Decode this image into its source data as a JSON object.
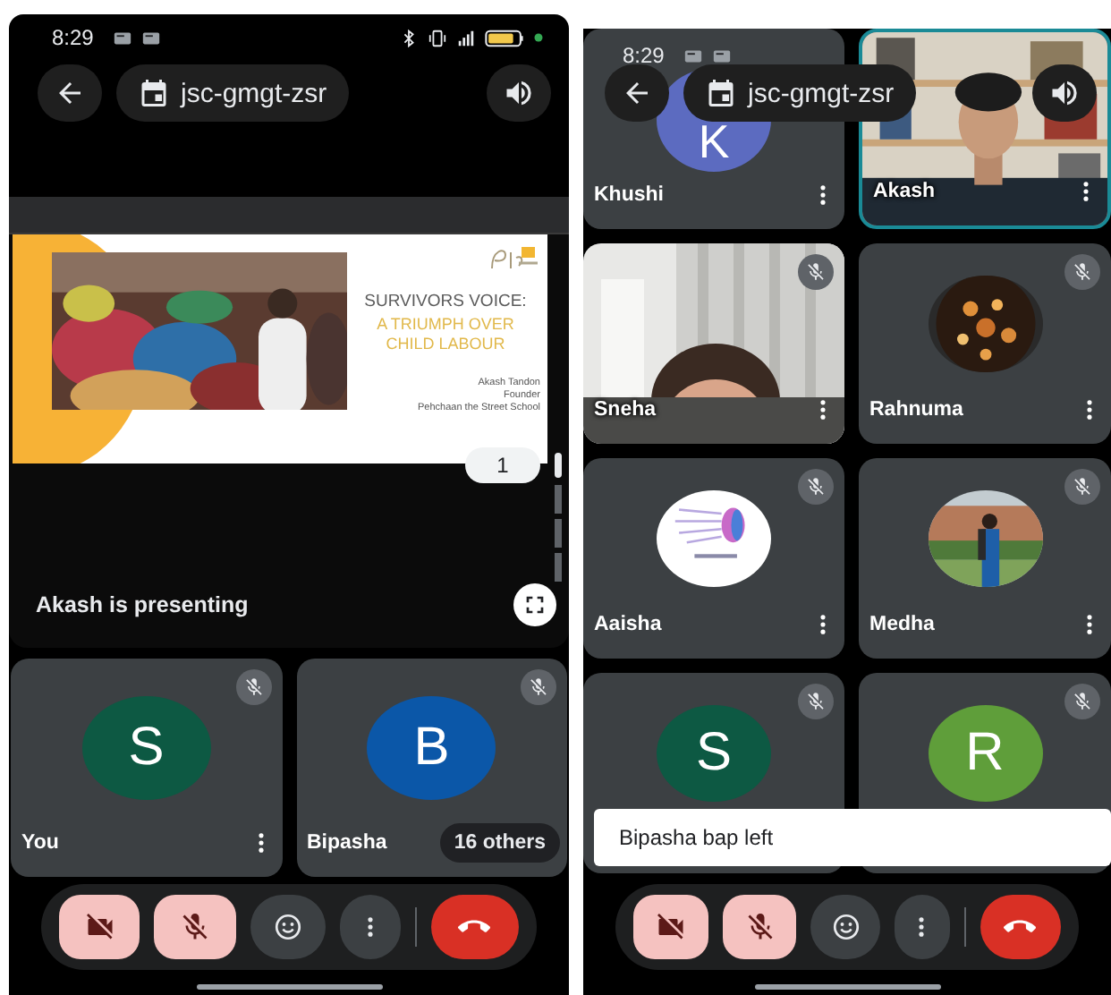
{
  "screens": [
    {
      "kind": "presentation",
      "status_bar": {
        "time": "8:29"
      },
      "meeting_code": "jsc-gmgt-zsr",
      "presentation": {
        "slide": {
          "title": "SURVIVORS VOICE:",
          "subtitle": "A TRIUMPH OVER CHILD LABOUR",
          "credits": [
            "Akash Tandon",
            "Founder",
            "Pehchaan the Street School"
          ]
        },
        "page": "1",
        "caption": "Akash is presenting"
      },
      "tiles": [
        {
          "name": "You",
          "kind": "letter",
          "initial": "S",
          "color": "#0d5943",
          "muted": true,
          "speaking": false,
          "menu": true
        },
        {
          "name": "Bipasha",
          "kind": "letter",
          "initial": "B",
          "color": "#0b57a8",
          "muted": true,
          "speaking": false,
          "menu": false,
          "badge": "16 others"
        }
      ],
      "controls": [
        {
          "kind": "camera",
          "on": false
        },
        {
          "kind": "mic",
          "on": false
        },
        {
          "kind": "reactions"
        },
        {
          "kind": "more"
        },
        {
          "kind": "end_call"
        }
      ]
    },
    {
      "kind": "grid",
      "status_bar": {
        "time": "8:29"
      },
      "meeting_code": "jsc-gmgt-zsr",
      "tiles": [
        {
          "name": "Khushi",
          "kind": "letter",
          "initial": "K",
          "color": "#5c6bc0",
          "muted": false,
          "speaking": false,
          "menu": true
        },
        {
          "name": "Akash",
          "kind": "video",
          "muted": false,
          "speaking": true,
          "menu": true
        },
        {
          "name": "Sneha",
          "kind": "video",
          "muted": true,
          "speaking": false,
          "menu": true
        },
        {
          "name": "Rahnuma",
          "muted": true,
          "speaking": false,
          "menu": true
        },
        {
          "name": "Aaisha",
          "muted": true,
          "speaking": false,
          "menu": true
        },
        {
          "name": "Medha",
          "muted": true,
          "speaking": false,
          "menu": true
        },
        {
          "kind": "letter",
          "initial": "S",
          "color": "#0d5943",
          "muted": true,
          "speaking": false,
          "menu": false
        },
        {
          "kind": "letter",
          "initial": "R",
          "color": "#5f9e3a",
          "muted": true,
          "speaking": false,
          "menu": false
        }
      ],
      "notice": "Bipasha bap left",
      "controls": [
        {
          "kind": "camera",
          "on": false
        },
        {
          "kind": "mic",
          "on": false
        },
        {
          "kind": "reactions"
        },
        {
          "kind": "more"
        },
        {
          "kind": "end_call"
        }
      ]
    }
  ]
}
